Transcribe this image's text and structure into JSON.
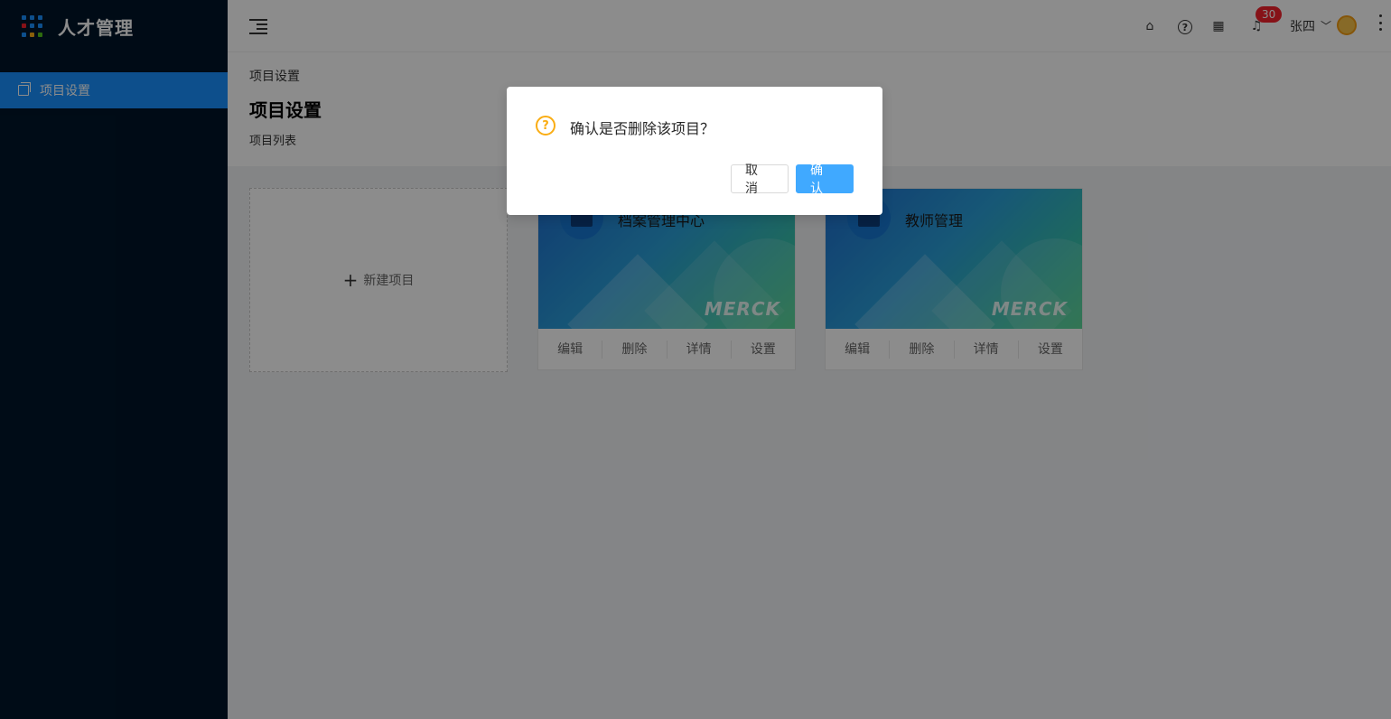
{
  "app": {
    "title": "人才管理"
  },
  "sidebar": {
    "items": [
      {
        "label": "项目设置",
        "icon": "copy-icon",
        "active": true
      }
    ]
  },
  "header": {
    "notification_count": "30",
    "user_name": "张四"
  },
  "page": {
    "breadcrumb": "项目设置",
    "title": "项目设置",
    "subtitle": "项目列表"
  },
  "new_project": {
    "label": "新建项目"
  },
  "projects": [
    {
      "name": "档案管理中心",
      "brand": "MERCK",
      "actions": [
        "编辑",
        "删除",
        "详情",
        "设置"
      ]
    },
    {
      "name": "教师管理",
      "brand": "MERCK",
      "actions": [
        "编辑",
        "删除",
        "详情",
        "设置"
      ]
    }
  ],
  "dialog": {
    "message": "确认是否删除该项目？",
    "cancel_label": "取 消",
    "ok_label": "确 认"
  },
  "colors": {
    "sidebar_bg": "#001529",
    "primary": "#1890ff",
    "warning": "#faad14",
    "badge": "#f5222d"
  }
}
